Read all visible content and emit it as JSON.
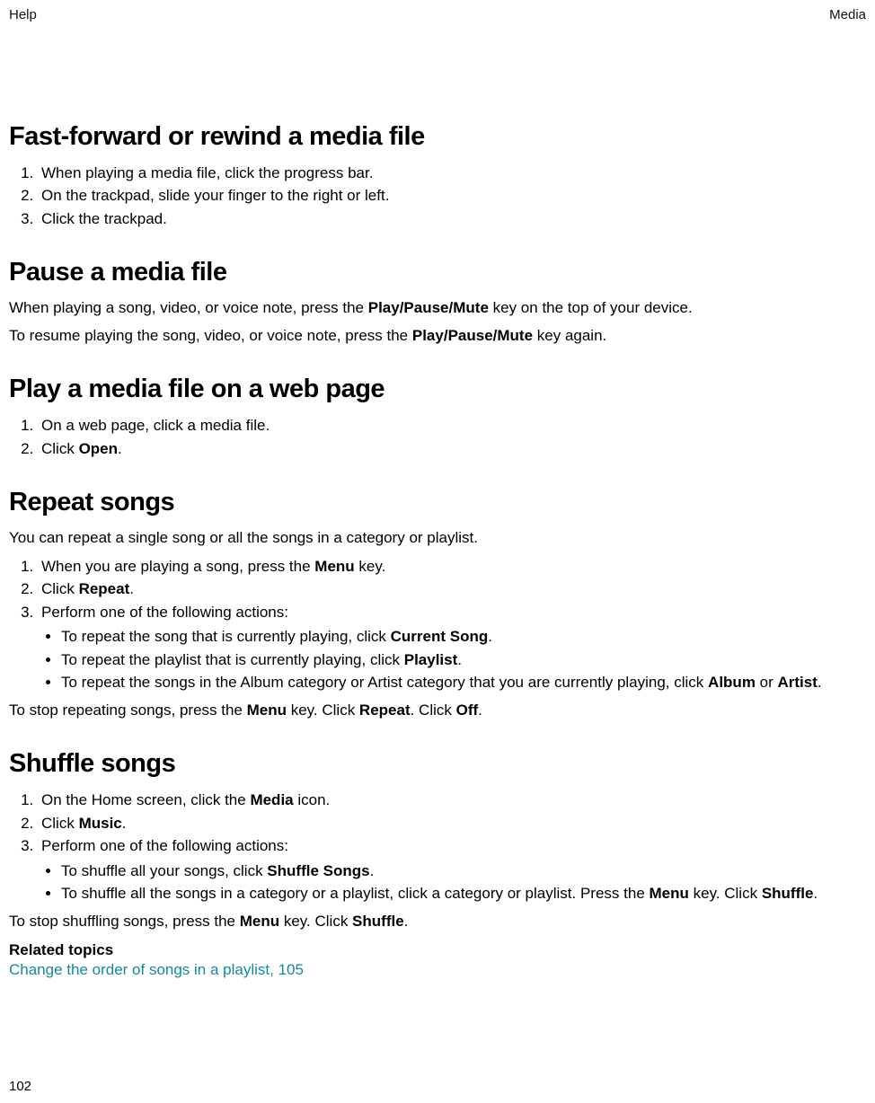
{
  "header": {
    "left": "Help",
    "right": "Media"
  },
  "pageNumber": "102",
  "sections": [
    {
      "heading": "Fast-forward or rewind a media file",
      "steps": [
        {
          "text": "When playing a media file, click the progress bar."
        },
        {
          "text": "On the trackpad, slide your finger to the right or left."
        },
        {
          "text": "Click the trackpad."
        }
      ]
    },
    {
      "heading": "Pause a media file",
      "paragraphs": [
        {
          "parts": [
            {
              "text": "When playing a song, video, or voice note, press the "
            },
            {
              "text": "Play/Pause/Mute",
              "bold": true
            },
            {
              "text": " key on the top of your device."
            }
          ]
        },
        {
          "parts": [
            {
              "text": "To resume playing the song, video, or voice note, press the "
            },
            {
              "text": "Play/Pause/Mute",
              "bold": true
            },
            {
              "text": " key again."
            }
          ]
        }
      ]
    },
    {
      "heading": "Play a media file on a web page",
      "steps": [
        {
          "text": "On a web page, click a media file."
        },
        {
          "parts": [
            {
              "text": "Click "
            },
            {
              "text": "Open",
              "bold": true
            },
            {
              "text": "."
            }
          ]
        }
      ]
    },
    {
      "heading": "Repeat songs",
      "intro": {
        "text": "You can repeat a single song or all the songs in a category or playlist."
      },
      "steps": [
        {
          "parts": [
            {
              "text": "When you are playing a song, press the "
            },
            {
              "text": "Menu",
              "bold": true
            },
            {
              "text": " key."
            }
          ]
        },
        {
          "parts": [
            {
              "text": "Click "
            },
            {
              "text": "Repeat",
              "bold": true
            },
            {
              "text": "."
            }
          ]
        },
        {
          "text": "Perform one of the following actions:",
          "sub": [
            {
              "parts": [
                {
                  "text": "To repeat the song that is currently playing, click "
                },
                {
                  "text": "Current Song",
                  "bold": true
                },
                {
                  "text": "."
                }
              ]
            },
            {
              "parts": [
                {
                  "text": "To repeat the playlist that is currently playing, click "
                },
                {
                  "text": "Playlist",
                  "bold": true
                },
                {
                  "text": "."
                }
              ]
            },
            {
              "parts": [
                {
                  "text": "To repeat the songs in the Album category or Artist category that you are currently playing, click "
                },
                {
                  "text": "Album",
                  "bold": true
                },
                {
                  "text": " or "
                },
                {
                  "text": "Artist",
                  "bold": true
                },
                {
                  "text": "."
                }
              ]
            }
          ]
        }
      ],
      "footer": {
        "parts": [
          {
            "text": "To stop repeating songs, press the "
          },
          {
            "text": "Menu",
            "bold": true
          },
          {
            "text": " key. Click "
          },
          {
            "text": "Repeat",
            "bold": true
          },
          {
            "text": ". Click "
          },
          {
            "text": "Off",
            "bold": true
          },
          {
            "text": "."
          }
        ]
      }
    },
    {
      "heading": "Shuffle songs",
      "steps": [
        {
          "parts": [
            {
              "text": "On the Home screen, click the "
            },
            {
              "text": "Media",
              "bold": true
            },
            {
              "text": " icon."
            }
          ]
        },
        {
          "parts": [
            {
              "text": "Click "
            },
            {
              "text": "Music",
              "bold": true
            },
            {
              "text": "."
            }
          ]
        },
        {
          "text": "Perform one of the following actions:",
          "sub": [
            {
              "parts": [
                {
                  "text": "To shuffle all your songs, click "
                },
                {
                  "text": "Shuffle Songs",
                  "bold": true
                },
                {
                  "text": "."
                }
              ]
            },
            {
              "parts": [
                {
                  "text": "To shuffle all the songs in a category or a playlist, click a category or playlist. Press the "
                },
                {
                  "text": "Menu",
                  "bold": true
                },
                {
                  "text": " key. Click "
                },
                {
                  "text": "Shuffle",
                  "bold": true
                },
                {
                  "text": "."
                }
              ]
            }
          ]
        }
      ],
      "footer": {
        "parts": [
          {
            "text": "To stop shuffling songs, press the "
          },
          {
            "text": "Menu",
            "bold": true
          },
          {
            "text": " key. Click "
          },
          {
            "text": "Shuffle",
            "bold": true
          },
          {
            "text": "."
          }
        ]
      },
      "related": {
        "heading": "Related topics",
        "link": "Change the order of songs in a playlist, 105"
      }
    }
  ]
}
